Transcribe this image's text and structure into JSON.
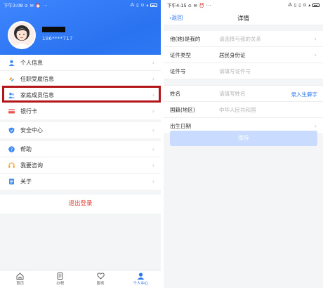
{
  "left": {
    "status": {
      "time": "下午3:08",
      "icons": "⊙ ✉ ⏰ ···",
      "right_icons": "⁂ ▯ ⊙ ▴"
    },
    "user": {
      "phone": "186****717"
    },
    "menu_group_1": [
      {
        "label": "个人信息",
        "icon": "person-icon"
      },
      {
        "label": "任职受雇信息",
        "icon": "link-icon"
      },
      {
        "label": "家庭成员信息",
        "icon": "family-icon"
      }
    ],
    "menu_group_2": [
      {
        "label": "银行卡",
        "icon": "bank-card-icon"
      }
    ],
    "menu_group_3": [
      {
        "label": "安全中心",
        "icon": "shield-icon"
      }
    ],
    "menu_group_4": [
      {
        "label": "帮助",
        "icon": "help-icon"
      },
      {
        "label": "我要咨询",
        "icon": "headset-icon"
      },
      {
        "label": "关于",
        "icon": "document-icon"
      }
    ],
    "logout_label": "退出登录",
    "tabs": [
      {
        "label": "首页",
        "icon": "home-icon"
      },
      {
        "label": "办税",
        "icon": "tax-icon"
      },
      {
        "label": "服务",
        "icon": "service-icon"
      },
      {
        "label": "个人中心",
        "icon": "user-center-icon",
        "active": true
      }
    ],
    "chevron": "›"
  },
  "right": {
    "status": {
      "time": "下午4:15",
      "icons": "⊙ ✉ ⏰ ···",
      "right_icons": "⁂ ▯ ▯ ⊙ ▴"
    },
    "back_label": "返回",
    "title": "详情",
    "fields_1": [
      {
        "label": "他(她)是我的",
        "value": "请选择与我的关系",
        "placeholder": true,
        "chevron": true
      },
      {
        "label": "证件类型",
        "value": "居民身份证",
        "placeholder": false,
        "chevron": true
      },
      {
        "label": "证件号",
        "value": "请填写证件号",
        "placeholder": true,
        "chevron": false
      }
    ],
    "fields_2": [
      {
        "label": "姓名",
        "value": "请填写姓名",
        "placeholder": true,
        "link": "录入生僻字"
      },
      {
        "label": "国籍(地区)",
        "value": "中华人民共和国",
        "placeholder": true,
        "chevron": false
      },
      {
        "label": "出生日期",
        "value": "",
        "placeholder": true,
        "chevron": true
      }
    ],
    "save_label": "保存",
    "chevron": "›"
  },
  "colors": {
    "accent": "#2a73f0",
    "highlight": "#b4151a",
    "logout": "#e0463c",
    "save_disabled": "#c9dcff"
  }
}
